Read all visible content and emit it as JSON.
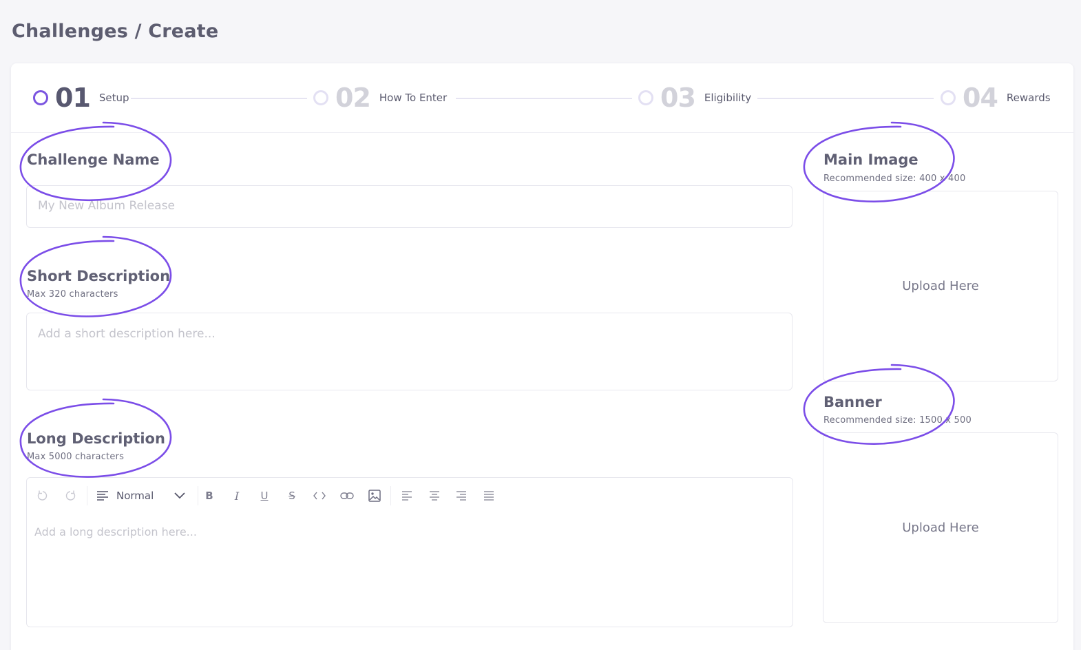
{
  "page": {
    "title": "Challenges / Create"
  },
  "steps": [
    {
      "number": "01",
      "label": "Setup"
    },
    {
      "number": "02",
      "label": "How To Enter"
    },
    {
      "number": "03",
      "label": "Eligibility"
    },
    {
      "number": "04",
      "label": "Rewards"
    }
  ],
  "form": {
    "challenge_name": {
      "label": "Challenge Name",
      "placeholder": "My New Album Release"
    },
    "short_description": {
      "label": "Short Description",
      "hint": "Max 320 characters",
      "placeholder": "Add a short description here..."
    },
    "long_description": {
      "label": "Long Description",
      "hint": "Max 5000 characters",
      "placeholder": "Add a long description here..."
    }
  },
  "editor": {
    "block_format": "Normal",
    "tools": [
      "undo-icon",
      "redo-icon",
      "format-icon",
      "bold-icon",
      "italic-icon",
      "underline-icon",
      "strikethrough-icon",
      "code-icon",
      "link-icon",
      "image-icon",
      "align-left-icon",
      "align-center-icon",
      "align-right-icon",
      "align-justify-icon"
    ]
  },
  "main_image": {
    "label": "Main Image",
    "hint": "Recommended size: 400 x 400",
    "upload": "Upload Here"
  },
  "banner": {
    "label": "Banner",
    "hint": "Recommended size: 1500 x 500",
    "upload": "Upload Here"
  },
  "colors": {
    "accent": "#7b55e0",
    "annotation": "#7b4de8"
  }
}
